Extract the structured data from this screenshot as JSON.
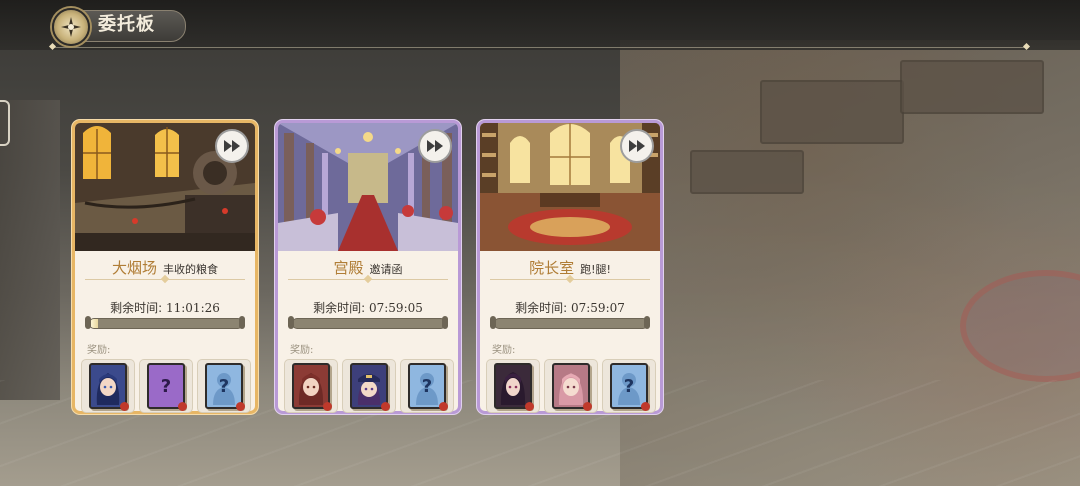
{
  "header": {
    "title": "委托板"
  },
  "labels": {
    "remaining_time": "剩余时间:",
    "rewards": "奖励:"
  },
  "cards": [
    {
      "place": "大烟场",
      "event": "丰收的粮食",
      "time": "11:01:26",
      "progress": 0.05,
      "frame": "gold",
      "rewards": [
        {
          "kind": "character",
          "icon": "blue-hair-character-icon",
          "color": "#3b4a8c"
        },
        {
          "kind": "unknown",
          "icon": "question-card-icon",
          "color": "#9a6ac8"
        },
        {
          "kind": "unknown",
          "icon": "question-silhouette-icon",
          "color": "#8fb7e0"
        }
      ]
    },
    {
      "place": "宫殿",
      "event": "邀请函",
      "time": "07:59:05",
      "progress": 0.0,
      "frame": "purple",
      "rewards": [
        {
          "kind": "character",
          "icon": "red-hair-character-icon",
          "color": "#8c3b35"
        },
        {
          "kind": "character",
          "icon": "captain-hat-character-icon",
          "color": "#3d3f7a"
        },
        {
          "kind": "unknown",
          "icon": "question-silhouette-icon",
          "color": "#8fb7e0"
        }
      ]
    },
    {
      "place": "院长室",
      "event": "跑!腿!",
      "time": "07:59:07",
      "progress": 0.0,
      "frame": "purple",
      "rewards": [
        {
          "kind": "character",
          "icon": "dark-hair-character-icon",
          "color": "#3b2a3a"
        },
        {
          "kind": "character",
          "icon": "pink-hair-character-icon",
          "color": "#b77a86"
        },
        {
          "kind": "unknown",
          "icon": "question-silhouette-icon",
          "color": "#8fb7e0"
        }
      ]
    }
  ]
}
